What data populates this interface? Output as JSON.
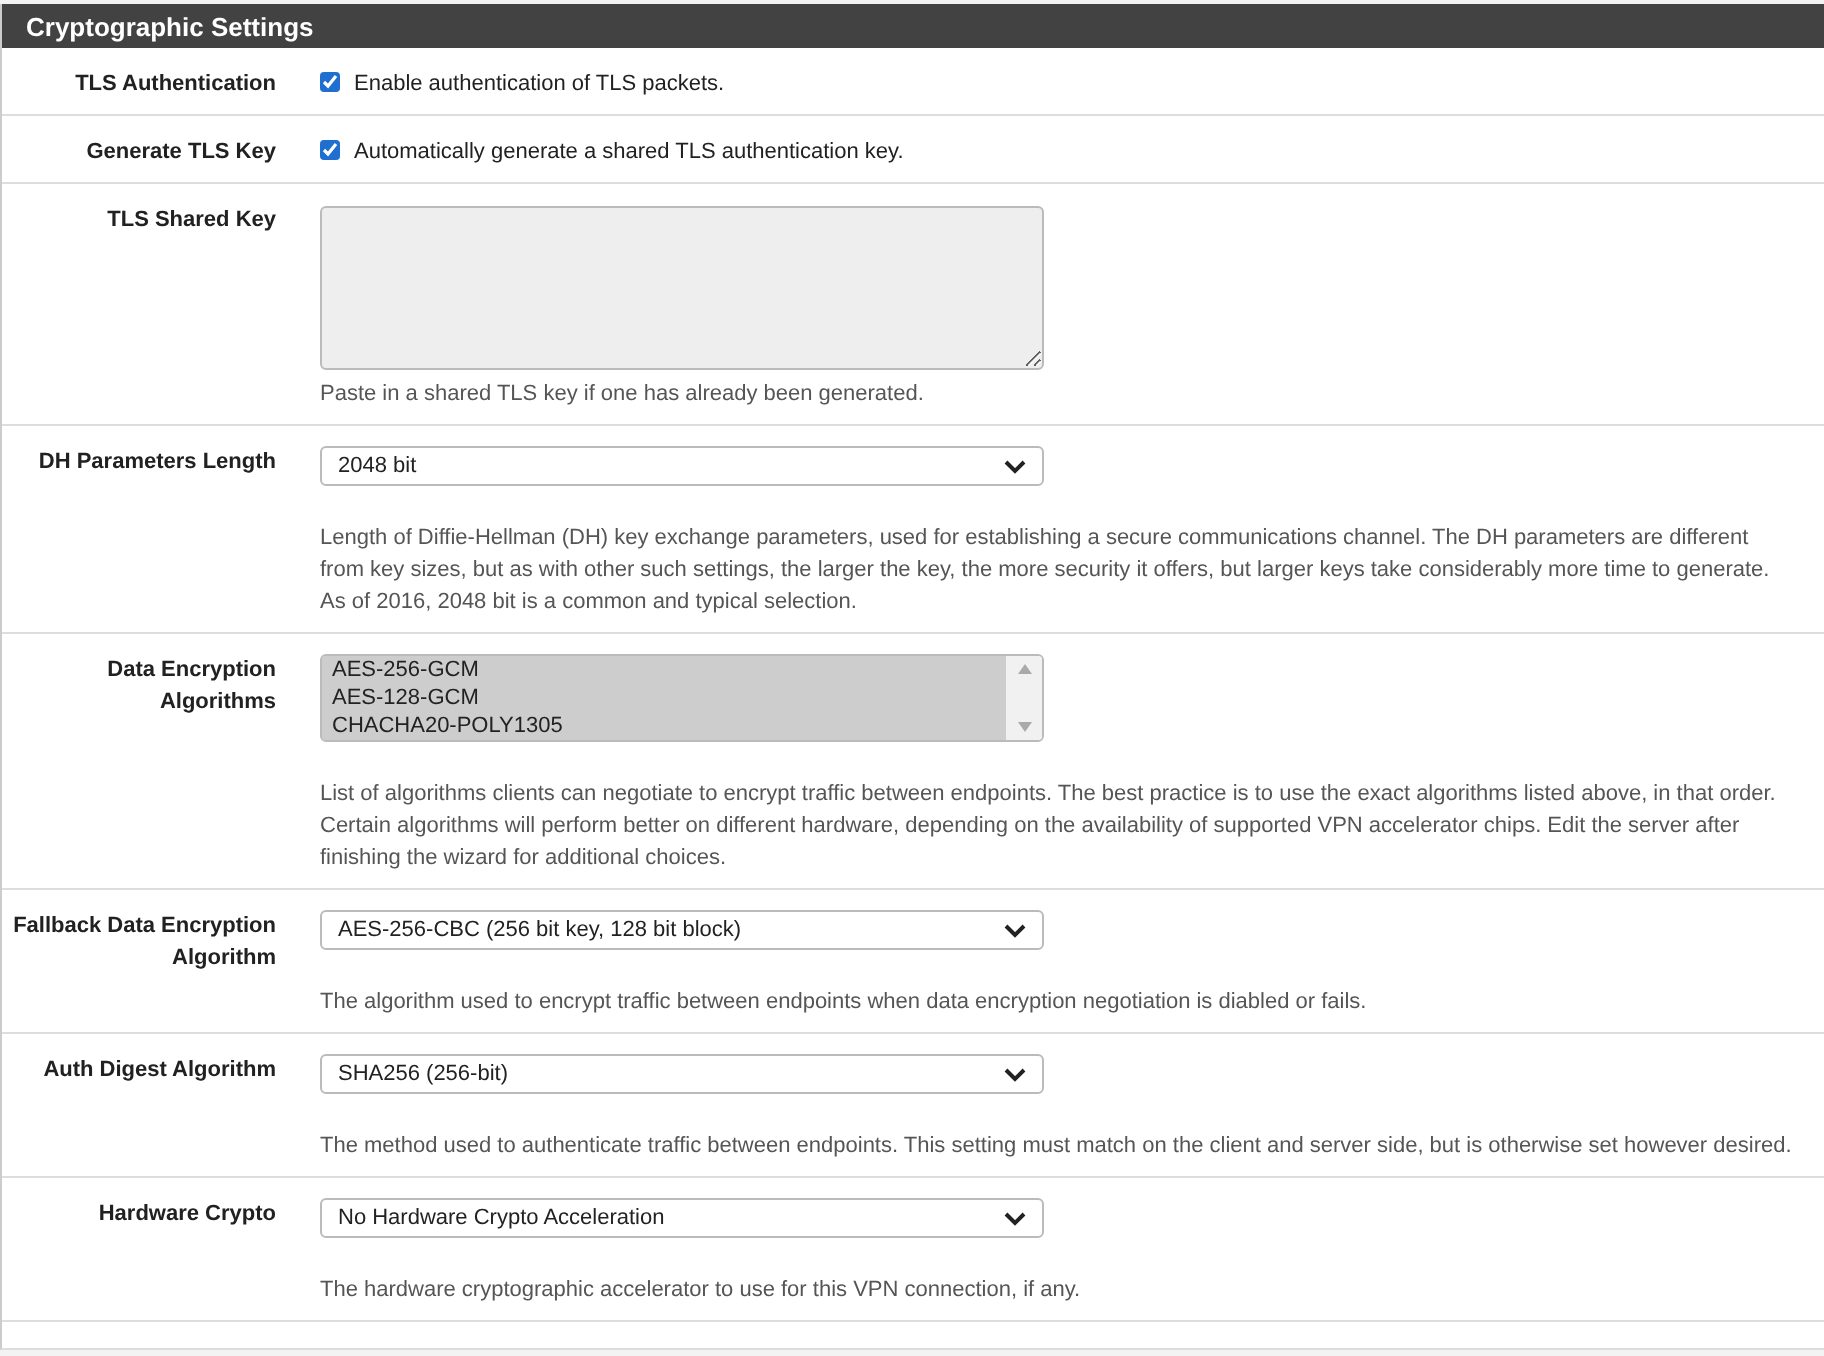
{
  "panel": {
    "title": "Cryptographic Settings"
  },
  "rows": [
    {
      "kind": "checkbox",
      "label": "TLS Authentication",
      "checked": true,
      "text": "Enable authentication of TLS packets."
    },
    {
      "kind": "checkbox",
      "label": "Generate TLS Key",
      "checked": true,
      "text": "Automatically generate a shared TLS authentication key."
    },
    {
      "kind": "textarea",
      "label": "TLS Shared Key",
      "disabled": true,
      "help": "Paste in a shared TLS key if one has already been generated."
    },
    {
      "kind": "select",
      "label": "DH Parameters Length",
      "value": "2048 bit",
      "help": "Length of Diffie-Hellman (DH) key exchange parameters, used for establishing a secure communications channel. The DH parameters are different from key sizes, but as with other such settings, the larger the key, the more security it offers, but larger keys take considerably more time to generate. As of 2016, 2048 bit is a common and typical selection."
    },
    {
      "kind": "multiselect",
      "label": "Data Encryption Algorithms",
      "options": [
        {
          "text": "AES-256-GCM",
          "selected": true
        },
        {
          "text": "AES-128-GCM",
          "selected": true
        },
        {
          "text": "CHACHA20-POLY1305",
          "selected": true
        }
      ],
      "help": "List of algorithms clients can negotiate to encrypt traffic between endpoints. The best practice is to use the exact algorithms listed above, in that order. Certain algorithms will perform better on different hardware, depending on the availability of supported VPN accelerator chips. Edit the server after finishing the wizard for additional choices."
    },
    {
      "kind": "select",
      "label": "Fallback Data Encryption Algorithm",
      "value": "AES-256-CBC (256 bit key, 128 bit block)",
      "help": "The algorithm used to encrypt traffic between endpoints when data encryption negotiation is diabled or fails."
    },
    {
      "kind": "select",
      "label": "Auth Digest Algorithm",
      "value": "SHA256 (256-bit)",
      "help": "The method used to authenticate traffic between endpoints. This setting must match on the client and server side, but is otherwise set however desired."
    },
    {
      "kind": "select",
      "label": "Hardware Crypto",
      "value": "No Hardware Crypto Acceleration",
      "help": "The hardware cryptographic accelerator to use for this VPN connection, if any."
    }
  ]
}
